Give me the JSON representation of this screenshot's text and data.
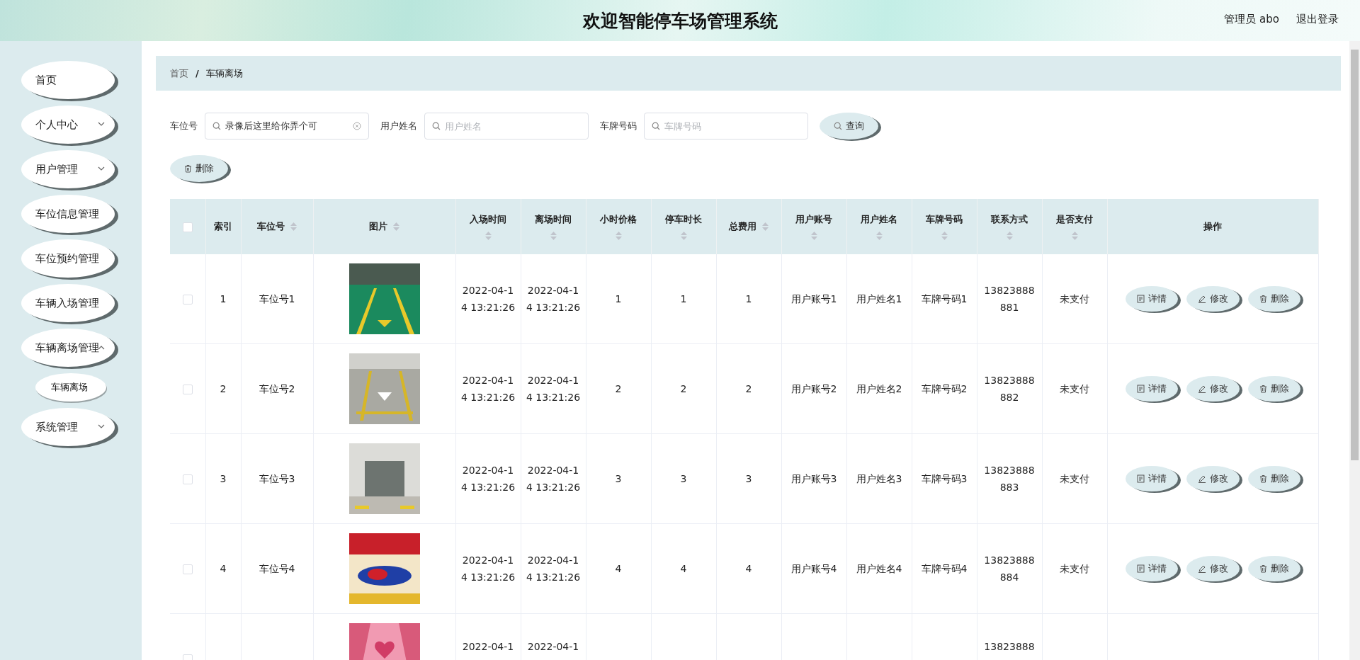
{
  "header": {
    "title": "欢迎智能停车场管理系统",
    "user": "管理员 abo",
    "logout": "退出登录"
  },
  "sidebar": {
    "items": [
      {
        "label": "首页",
        "kind": "link"
      },
      {
        "label": "个人中心",
        "kind": "submenu",
        "expanded": false
      },
      {
        "label": "用户管理",
        "kind": "submenu",
        "expanded": false
      },
      {
        "label": "车位信息管理",
        "kind": "link"
      },
      {
        "label": "车位预约管理",
        "kind": "link"
      },
      {
        "label": "车辆入场管理",
        "kind": "link"
      },
      {
        "label": "车辆离场管理",
        "kind": "submenu",
        "expanded": true,
        "children": [
          {
            "label": "车辆离场",
            "selected": true
          }
        ]
      },
      {
        "label": "系统管理",
        "kind": "submenu",
        "expanded": false
      }
    ]
  },
  "breadcrumb": {
    "items": [
      "首页",
      "车辆离场"
    ],
    "separator": "/"
  },
  "search": {
    "fields": [
      {
        "label": "车位号",
        "value": "录像后这里给你弄个可"
      },
      {
        "label": "用户姓名",
        "placeholder": "用户姓名"
      },
      {
        "label": "车牌号码",
        "placeholder": "车牌号码"
      }
    ],
    "query_button": "查询"
  },
  "delete_button": "删除",
  "table": {
    "all_checked": false,
    "columns": [
      {
        "label": "索引",
        "kind": "plain"
      },
      {
        "label": "车位号",
        "kind": "sort_inline"
      },
      {
        "label": "图片",
        "kind": "sort_inline"
      },
      {
        "label": "入场时间",
        "kind": "sort_below"
      },
      {
        "label": "离场时间",
        "kind": "sort_below"
      },
      {
        "label": "小时价格",
        "kind": "sort_below"
      },
      {
        "label": "停车时长",
        "kind": "sort_below"
      },
      {
        "label": "总费用",
        "kind": "sort_inline"
      },
      {
        "label": "用户账号",
        "kind": "sort_below"
      },
      {
        "label": "用户姓名",
        "kind": "sort_below"
      },
      {
        "label": "车牌号码",
        "kind": "sort_below"
      },
      {
        "label": "联系方式",
        "kind": "sort_below"
      },
      {
        "label": "是否支付",
        "kind": "sort_below"
      },
      {
        "label": "操作",
        "kind": "plain"
      }
    ],
    "rows": [
      {
        "checked": false,
        "cells": [
          "1",
          "车位号1",
          null,
          "2022-04-14 13:21:26",
          "2022-04-14 13:21:26",
          "1",
          "1",
          "1",
          "用户账号1",
          "用户姓名1",
          "车牌号码1",
          "13823888881",
          "未支付"
        ],
        "actions": [
          "详情",
          "修改",
          "删除"
        ]
      },
      {
        "checked": false,
        "cells": [
          "2",
          "车位号2",
          null,
          "2022-04-14 13:21:26",
          "2022-04-14 13:21:26",
          "2",
          "2",
          "2",
          "用户账号2",
          "用户姓名2",
          "车牌号码2",
          "13823888882",
          "未支付"
        ],
        "actions": [
          "详情",
          "修改",
          "删除"
        ]
      },
      {
        "checked": false,
        "cells": [
          "3",
          "车位号3",
          null,
          "2022-04-14 13:21:26",
          "2022-04-14 13:21:26",
          "3",
          "3",
          "3",
          "用户账号3",
          "用户姓名3",
          "车牌号码3",
          "13823888883",
          "未支付"
        ],
        "actions": [
          "详情",
          "修改",
          "删除"
        ]
      },
      {
        "checked": false,
        "cells": [
          "4",
          "车位号4",
          null,
          "2022-04-14 13:21:26",
          "2022-04-14 13:21:26",
          "4",
          "4",
          "4",
          "用户账号4",
          "用户姓名4",
          "车牌号码4",
          "13823888884",
          "未支付"
        ],
        "actions": [
          "详情",
          "修改",
          "删除"
        ]
      },
      {
        "checked": false,
        "cells": [
          null,
          null,
          null,
          "2022-04-1",
          "2022-04-1",
          null,
          null,
          null,
          null,
          null,
          null,
          "13823888",
          null
        ]
      }
    ]
  }
}
